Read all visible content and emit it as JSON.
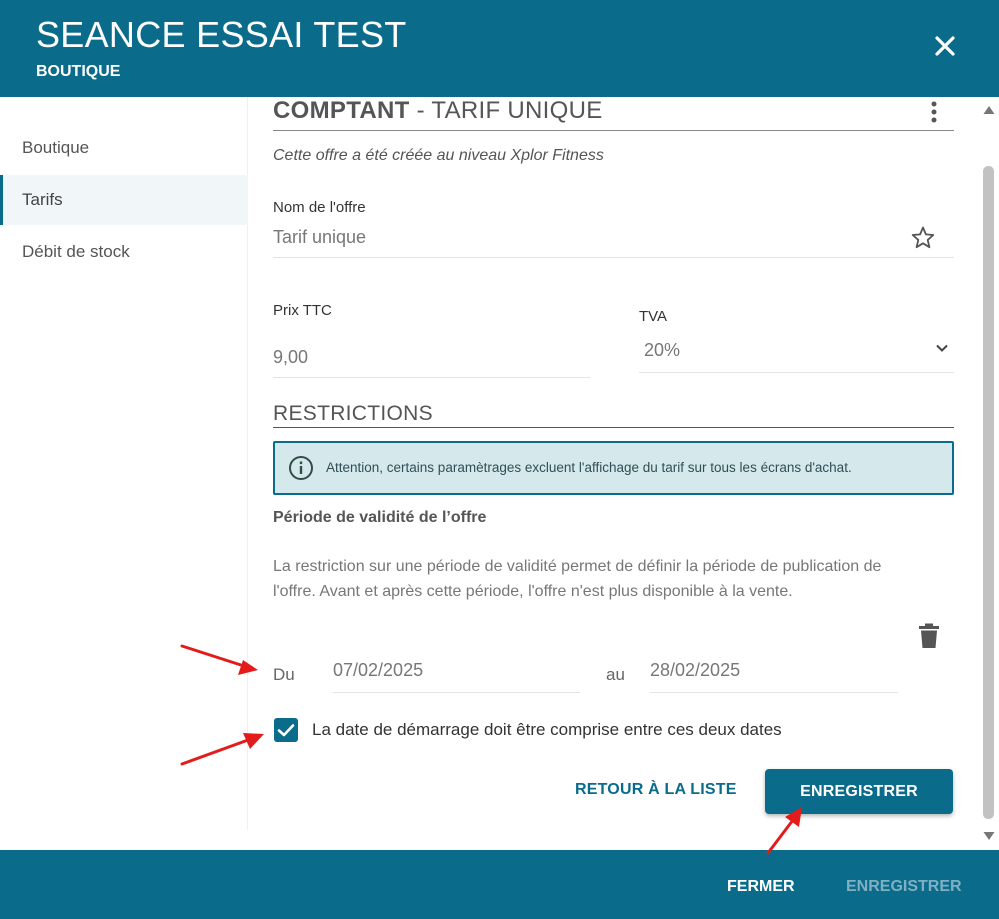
{
  "header": {
    "title": "SEANCE ESSAI TEST",
    "subtitle": "BOUTIQUE",
    "close_icon": "close-icon"
  },
  "sidebar": {
    "items": [
      {
        "label": "Boutique",
        "active": false
      },
      {
        "label": "Tarifs",
        "active": true
      },
      {
        "label": "Débit de stock",
        "active": false
      }
    ]
  },
  "offer": {
    "title_bold": "COMPTANT",
    "title_rest": " - TARIF UNIQUE",
    "created_note": "Cette offre a été créée au niveau Xplor Fitness",
    "name_label": "Nom de l'offre",
    "name_value": "Tarif unique",
    "price_label": "Prix TTC",
    "price_value": "9,00",
    "tva_label": "TVA",
    "tva_value": "20%"
  },
  "restrictions": {
    "title": "RESTRICTIONS",
    "alert_text": "Attention, certains paramètrages excluent l'affichage du tarif sur tous les écrans d'achat.",
    "period_title": "Période de validité de l’offre",
    "period_description": "La restriction sur une période de validité permet de définir la période de publication de l'offre. Avant et après cette période, l'offre n'est plus disponible à la vente.",
    "from_label": "Du",
    "from_value": "07/02/2025",
    "to_label": "au",
    "to_value": "28/02/2025",
    "checkbox_label": "La date de démarrage doit être comprise entre ces deux dates",
    "checkbox_checked": true
  },
  "actions": {
    "back_label": "RETOUR À LA LISTE",
    "save_label": "ENREGISTRER"
  },
  "footer": {
    "close_label": "FERMER",
    "save_label": "ENREGISTRER"
  },
  "colors": {
    "brand": "#0b6b8a",
    "alert_bg": "#d5e8ec",
    "annotation_arrow": "#e31b1b"
  }
}
